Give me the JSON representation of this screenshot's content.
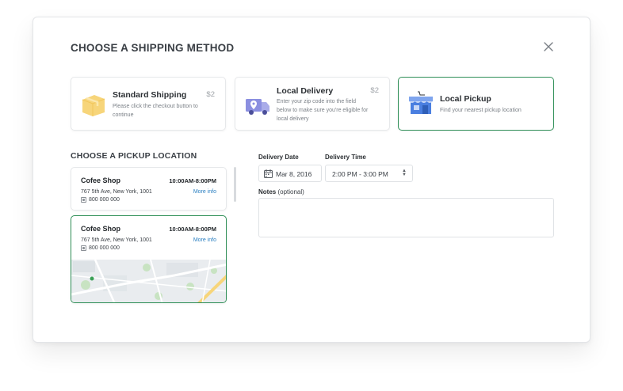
{
  "modal": {
    "title": "CHOOSE A SHIPPING METHOD",
    "close_icon": "close-icon"
  },
  "shipping_methods": [
    {
      "title": "Standard Shipping",
      "description": "Please click the checkout button to continue",
      "price": "$2",
      "icon": "box-icon",
      "selected": false
    },
    {
      "title": "Local Delivery",
      "description": "Enter your zip code into the field below to make sure you're eligible for local delivery",
      "price": "$2",
      "icon": "delivery-truck-icon",
      "selected": false
    },
    {
      "title": "Local Pickup",
      "description": "Find your nearest pickup location",
      "price": "",
      "icon": "store-icon",
      "selected": true
    }
  ],
  "pickup": {
    "section_title": "CHOOSE A PICKUP LOCATION",
    "locations": [
      {
        "name": "Cofee Shop",
        "hours": "10:00AM-8:00PM",
        "address": "767 5th Ave, New York, 1001",
        "phone": "800 000 000",
        "more_info": "More info",
        "selected": false
      },
      {
        "name": "Cofee Shop",
        "hours": "10:00AM-8:00PM",
        "address": "767 5th Ave, New York, 1001",
        "phone": "800 000 000",
        "more_info": "More info",
        "selected": true
      }
    ]
  },
  "delivery": {
    "date_label": "Delivery Date",
    "date_value": "Mar 8, 2016",
    "time_label": "Delivery Time",
    "time_value": "2:00 PM - 3:00 PM",
    "notes_label": "Notes",
    "notes_optional": "(optional)",
    "notes_value": ""
  },
  "colors": {
    "selected_border": "#2f8f57",
    "link": "#2a7fc1",
    "box_icon": "#f7d57a",
    "truck_icon": "#8b8fe0",
    "store_icon": "#4a7fe0"
  }
}
